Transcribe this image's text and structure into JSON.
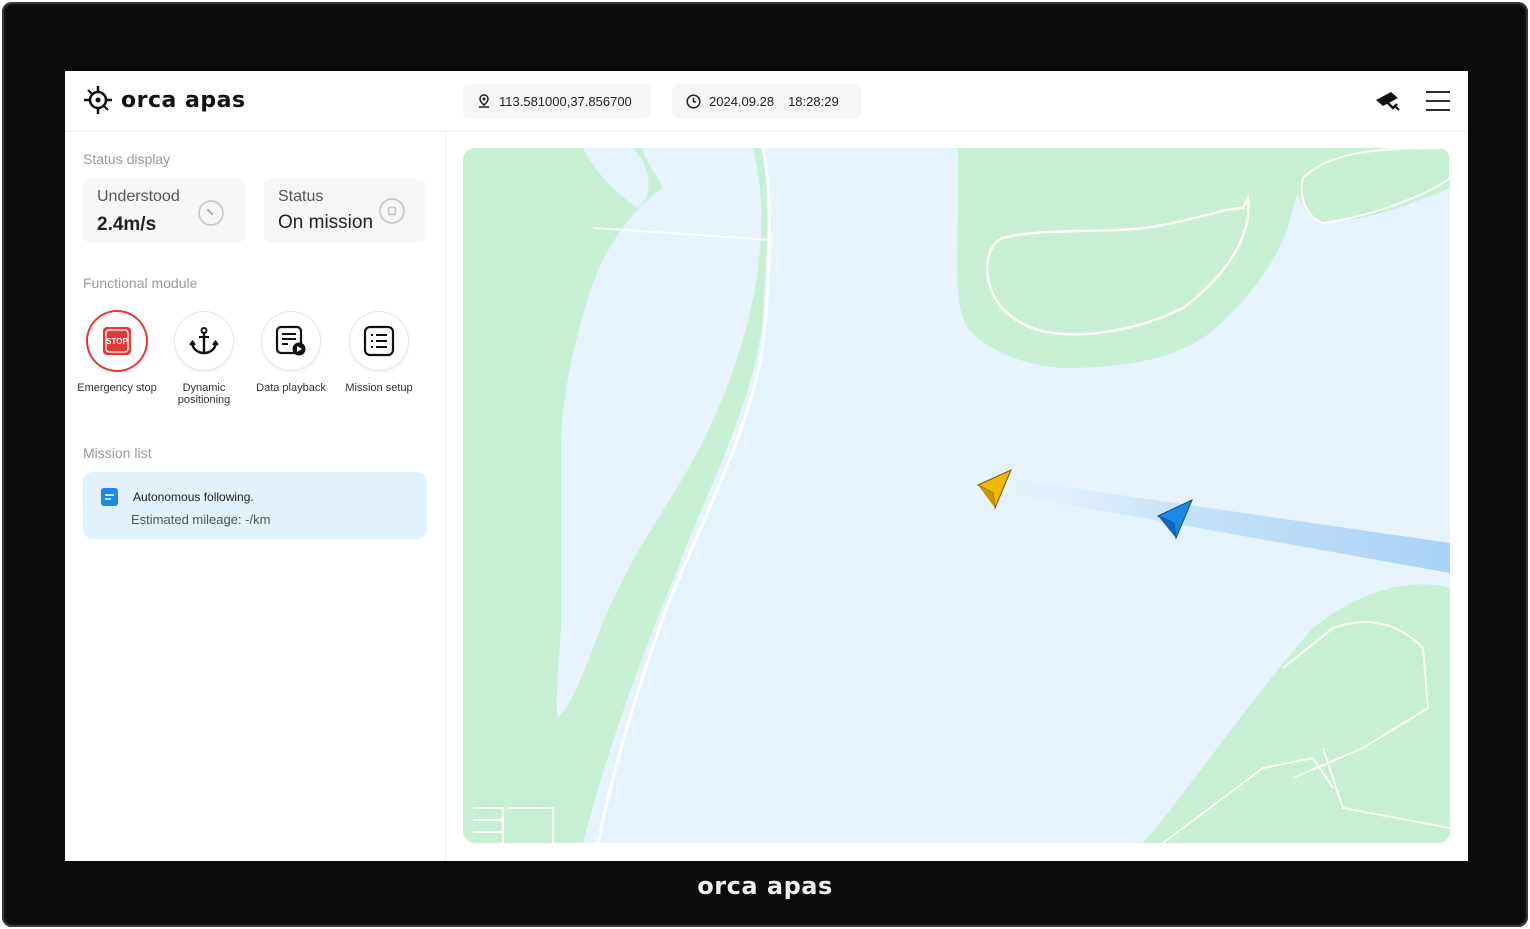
{
  "brand": {
    "name": "orca apas"
  },
  "header": {
    "coordinates": "113.581000,37.856700",
    "date": "2024.09.28",
    "time": "18:28:29",
    "icons": [
      "location-pin-icon",
      "clock-icon",
      "drone-icon",
      "menu-icon"
    ]
  },
  "status_display": {
    "label": "Status display",
    "cards": [
      {
        "key": "Understood",
        "value": "2.4m/s",
        "icon": "gauge-icon"
      },
      {
        "key": "Status",
        "value": "On mission",
        "icon": "status-icon"
      }
    ]
  },
  "functional_module": {
    "label": "Functional module",
    "items": [
      {
        "label": "Emergency stop",
        "icon": "stop-icon",
        "accent": "#e53935"
      },
      {
        "label": "Dynamic positioning",
        "icon": "anchor-icon"
      },
      {
        "label": "Data playback",
        "icon": "playback-icon"
      },
      {
        "label": "Mission setup",
        "icon": "checklist-icon"
      }
    ]
  },
  "mission_list": {
    "label": "Mission list",
    "items": [
      {
        "title": "Autonomous following.",
        "mileage": "Estimated mileage:  -/km"
      }
    ]
  },
  "map": {
    "water_color": "#e6f3fd",
    "land_color": "#c6efd3",
    "markers": [
      {
        "name": "leader-vessel",
        "color": "#f2b705"
      },
      {
        "name": "follower-vessel",
        "color": "#1e88e5"
      }
    ]
  },
  "footer": {
    "brand": "orca apas"
  }
}
